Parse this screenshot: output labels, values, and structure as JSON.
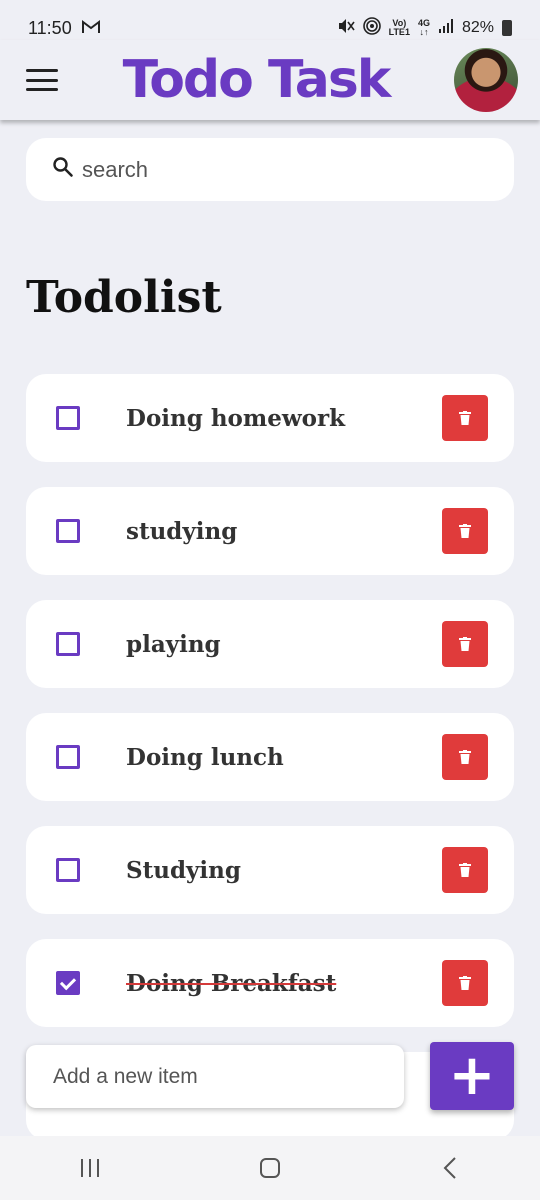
{
  "status_bar": {
    "time": "11:50",
    "volte_top": "Vo)",
    "volte_bottom": "LTE1",
    "net_top": "4G",
    "net_bottom": "↓↑",
    "battery": "82%"
  },
  "app_bar": {
    "title": "Todo Task"
  },
  "search": {
    "placeholder": "search"
  },
  "heading": "Todolist",
  "todos": [
    {
      "text": "Doing homework",
      "done": false
    },
    {
      "text": "studying",
      "done": false
    },
    {
      "text": "playing",
      "done": false
    },
    {
      "text": "Doing lunch",
      "done": false
    },
    {
      "text": "Studying",
      "done": false
    },
    {
      "text": "Doing Breakfast",
      "done": true
    }
  ],
  "add_item": {
    "placeholder": "Add a new item",
    "button_label": "+"
  },
  "colors": {
    "accent": "#6A3BC2",
    "delete": "#E03B3B",
    "background": "#EEEFF5"
  }
}
